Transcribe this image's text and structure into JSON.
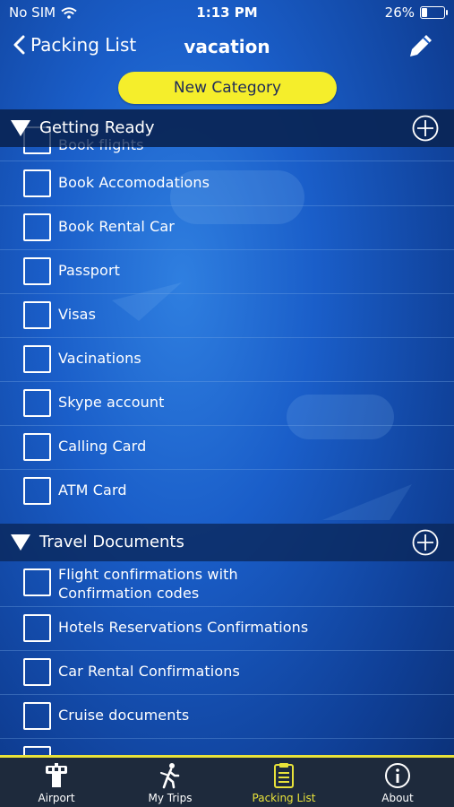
{
  "status_bar": {
    "carrier": "No SIM",
    "time": "1:13 PM",
    "battery_percent": "26%",
    "battery_level": 0.26
  },
  "nav": {
    "back_label": "Packing List",
    "title": "vacation"
  },
  "new_category_label": "New Category",
  "sections": [
    {
      "title": "Getting Ready",
      "items": [
        "Book flights",
        "Book Accomodations",
        "Book Rental Car",
        "Passport",
        "Visas",
        "Vacinations",
        "Skype account",
        "Calling Card",
        "ATM Card"
      ]
    },
    {
      "title": "Travel Documents",
      "items": [
        "Flight confirmations with Confirmation codes",
        "Hotels Reservations Confirmations",
        "Car Rental Confirmations",
        "Cruise documents"
      ]
    }
  ],
  "tabs": [
    {
      "label": "Airport",
      "icon": "control-tower-icon"
    },
    {
      "label": "My Trips",
      "icon": "walking-traveler-icon"
    },
    {
      "label": "Packing List",
      "icon": "clipboard-icon",
      "active": true
    },
    {
      "label": "About",
      "icon": "info-icon"
    }
  ],
  "colors": {
    "accent": "#f5ee2b",
    "tab_active": "#e8e23a",
    "background": "#1a5ec9"
  }
}
